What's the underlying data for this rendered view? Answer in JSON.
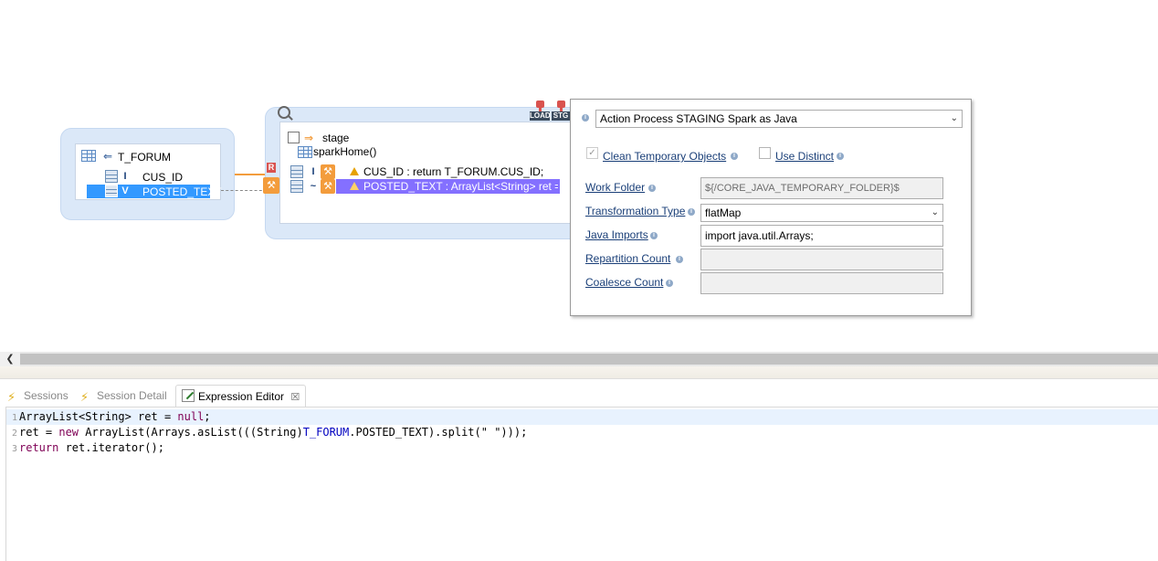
{
  "diagram": {
    "source": {
      "name": "T_FORUM",
      "columns": [
        {
          "tag": "I",
          "name": "CUS_ID"
        },
        {
          "tag": "V",
          "name": "POSTED_TEXT"
        }
      ]
    },
    "target": {
      "stage_label": "stage",
      "spark_label": "sparkHome()",
      "rows": [
        {
          "tag": "I",
          "text": "CUS_ID : return T_FORUM.CUS_ID;"
        },
        {
          "tag": "~",
          "text": "POSTED_TEXT : ArrayList<String> ret =..."
        }
      ],
      "badges": [
        "LOAD",
        "STG"
      ],
      "marker": "R"
    }
  },
  "properties": {
    "action_process": "Action Process STAGING Spark as Java",
    "clean_temp_label": "Clean Temporary Objects",
    "clean_temp_checked": true,
    "use_distinct_label": "Use Distinct",
    "use_distinct_checked": false,
    "work_folder_label": "Work Folder",
    "work_folder_value": "${/CORE_JAVA_TEMPORARY_FOLDER}$",
    "transformation_type_label": "Transformation Type",
    "transformation_type_value": "flatMap",
    "java_imports_label": "Java Imports",
    "java_imports_value": "import java.util.Arrays;",
    "repartition_label": "Repartition Count",
    "repartition_value": "",
    "coalesce_label": "Coalesce Count",
    "coalesce_value": ""
  },
  "tabs": [
    {
      "label": "Sessions",
      "active": false
    },
    {
      "label": "Session Detail",
      "active": false
    },
    {
      "label": "Expression Editor",
      "active": true
    }
  ],
  "close_glyph": "☒",
  "editor": {
    "lines": [
      {
        "num": "1"
      },
      {
        "num": "2"
      },
      {
        "num": "3"
      }
    ]
  },
  "colors": {
    "accent": "#3399ff",
    "selection_purple": "#8470ff",
    "wrench": "#f39c3c",
    "container": "#dbe8f8"
  }
}
